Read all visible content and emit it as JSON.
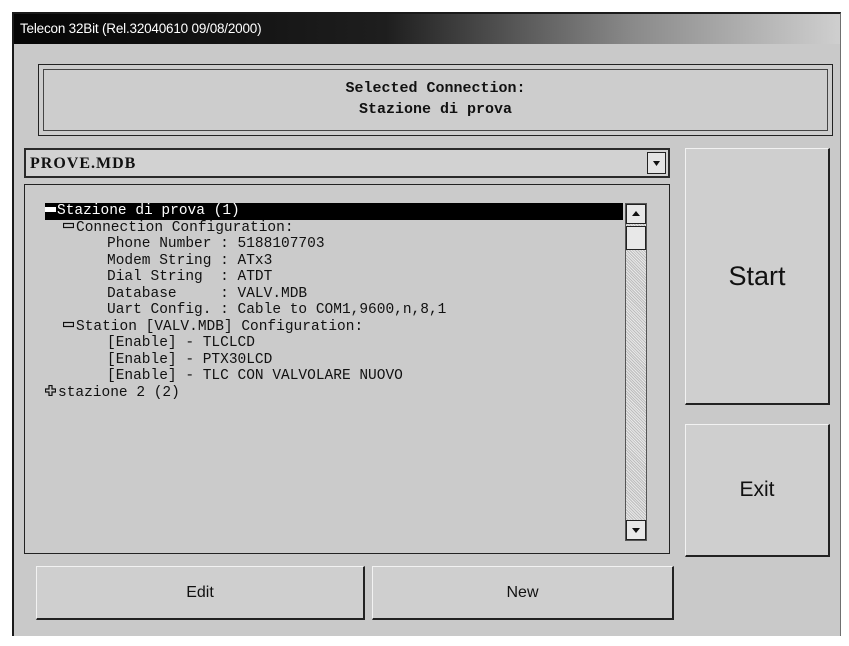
{
  "window": {
    "title": "Telecon 32Bit (Rel.32040610 09/08/2000)"
  },
  "connection": {
    "line1": "Selected Connection:",
    "line2": "Stazione di prova"
  },
  "database_select": {
    "value": "PROVE.MDB"
  },
  "tree": [
    {
      "text": "Stazione di prova (1)",
      "toggle": "minus-bold",
      "indent": 0,
      "selected": true
    },
    {
      "text": "Connection Configuration:",
      "toggle": "minus",
      "indent": 1
    },
    {
      "text": "Phone Number : 5188107703",
      "toggle": "",
      "indent": 3
    },
    {
      "text": "Modem String : ATx3",
      "toggle": "",
      "indent": 3
    },
    {
      "text": "Dial String  : ATDT",
      "toggle": "",
      "indent": 3
    },
    {
      "text": "Database     : VALV.MDB",
      "toggle": "",
      "indent": 3
    },
    {
      "text": "Uart Config. : Cable to COM1,9600,n,8,1",
      "toggle": "",
      "indent": 3
    },
    {
      "text": "Station [VALV.MDB] Configuration:",
      "toggle": "minus",
      "indent": 1
    },
    {
      "text": "[Enable] - TLCLCD",
      "toggle": "",
      "indent": 3
    },
    {
      "text": "[Enable] - PTX30LCD",
      "toggle": "",
      "indent": 3
    },
    {
      "text": "[Enable] - TLC CON VALVOLARE NUOVO",
      "toggle": "",
      "indent": 3
    },
    {
      "text": "stazione 2 (2)",
      "toggle": "plus",
      "indent": 0
    }
  ],
  "buttons": {
    "start": "Start",
    "exit": "Exit",
    "edit": "Edit",
    "new": "New"
  }
}
